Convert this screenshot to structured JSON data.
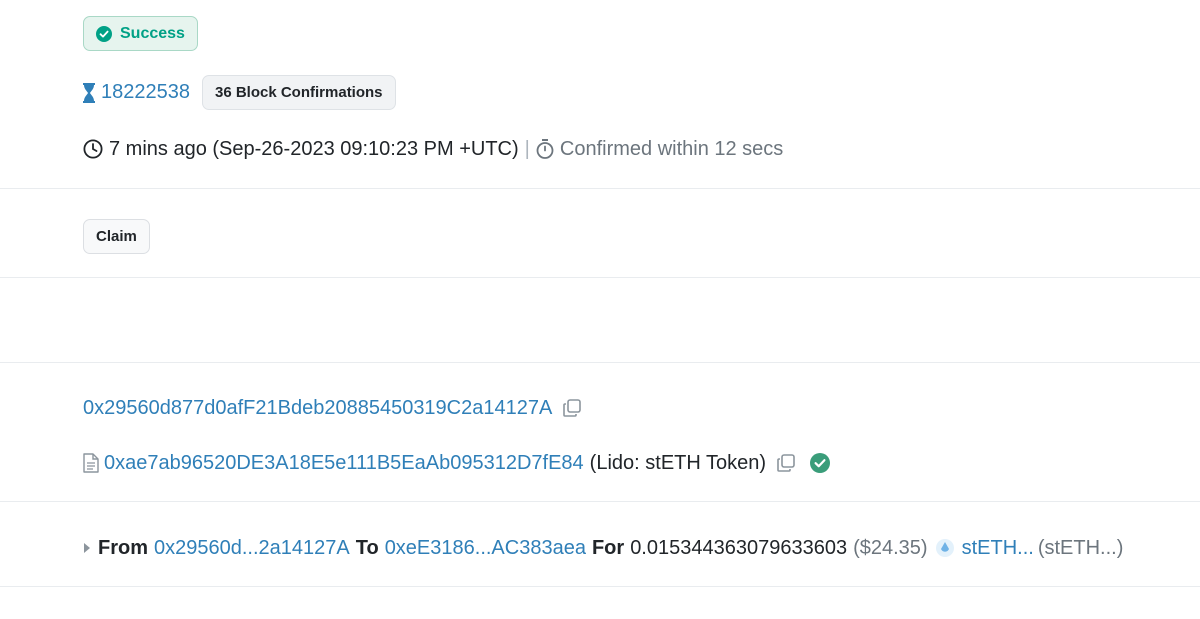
{
  "status": {
    "label": "Success",
    "icon": "check-circle-icon",
    "color": "#00a186"
  },
  "block": {
    "number": "18222538",
    "confirmations": "36 Block Confirmations",
    "icon": "hourglass-icon"
  },
  "timestamp": {
    "text": "7 mins ago (Sep-26-2023 09:10:23 PM +UTC)",
    "separator": "|",
    "confirmed": "Confirmed within 12 secs"
  },
  "method": {
    "label": "Claim"
  },
  "from_address": {
    "address": "0x29560d877d0afF21Bdeb20885450319C2a14127A"
  },
  "to_contract": {
    "address": "0xae7ab96520DE3A18E5e111B5EaAb095312D7fE84",
    "name": "(Lido: stETH Token)"
  },
  "transfer": {
    "from_label": "From",
    "from": "0x29560d...2a14127A",
    "to_label": "To",
    "to": "0xeE3186...AC383aea",
    "for_label": "For",
    "amount": "0.015344363079633603",
    "usd": "($24.35)",
    "token": "stETH...",
    "token_full": "(stETH...)"
  },
  "colors": {
    "link": "#2f7fb8",
    "success": "#00a186",
    "muted": "#6c757d"
  }
}
